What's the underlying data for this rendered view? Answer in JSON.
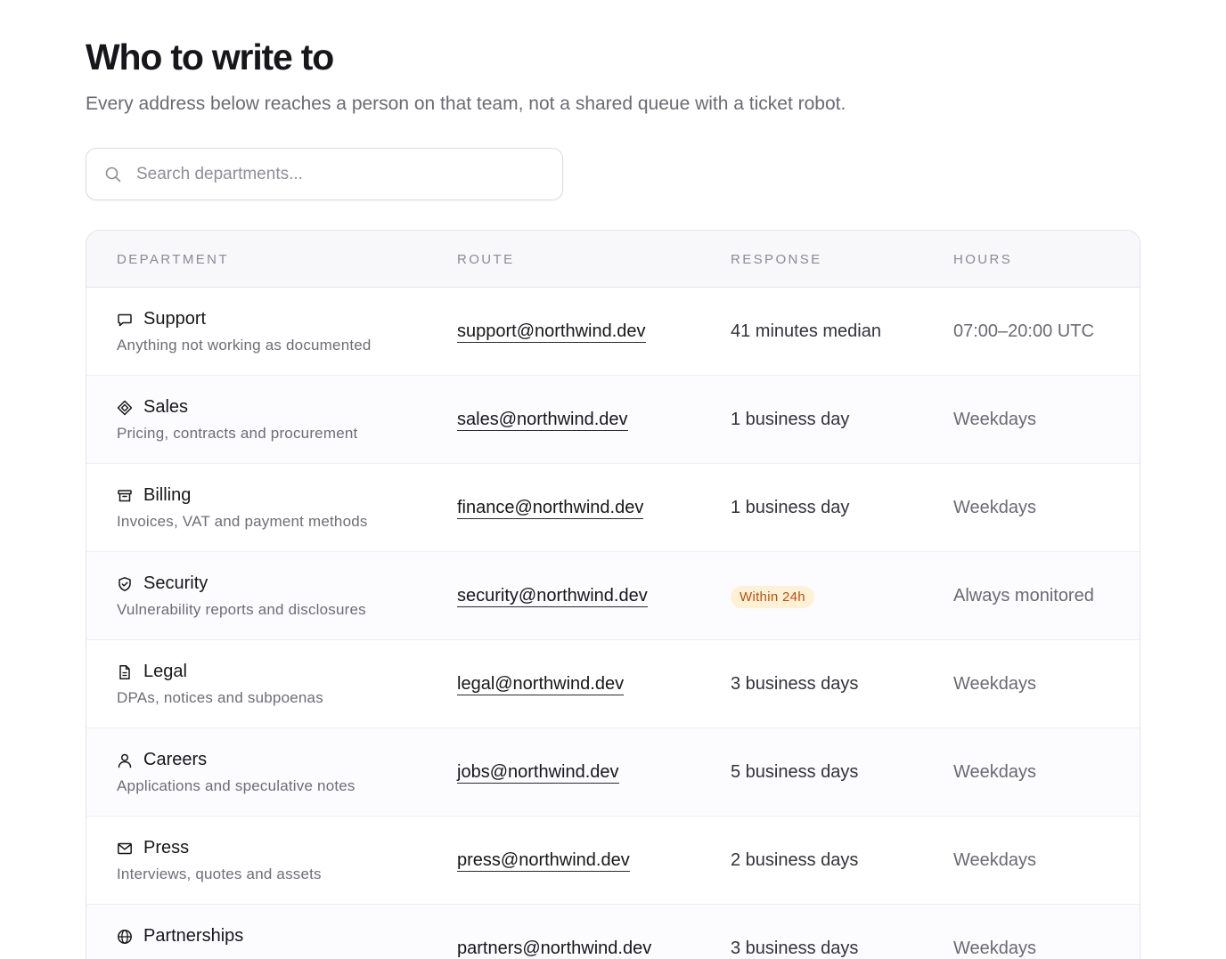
{
  "header": {
    "title": "Who to write to",
    "subtitle": "Every address below reaches a person on that team, not a shared queue with a ticket robot."
  },
  "search": {
    "placeholder": "Search departments...",
    "value": "",
    "icon": "search-icon"
  },
  "table": {
    "columns": [
      "DEPARTMENT",
      "ROUTE",
      "RESPONSE",
      "HOURS"
    ],
    "rows": [
      {
        "icon": "chat-bubble-icon",
        "name": "Support",
        "description": "Anything not working as documented",
        "route": "support@northwind.dev",
        "response": "41 minutes median",
        "hours": "07:00–20:00 UTC"
      },
      {
        "icon": "diamond-icon",
        "name": "Sales",
        "description": "Pricing, contracts and procurement",
        "route": "sales@northwind.dev",
        "response": "1 business day",
        "hours": "Weekdays"
      },
      {
        "icon": "archive-box-icon",
        "name": "Billing",
        "description": "Invoices, VAT and payment methods",
        "route": "finance@northwind.dev",
        "response": "1 business day",
        "hours": "Weekdays"
      },
      {
        "icon": "shield-check-icon",
        "name": "Security",
        "description": "Vulnerability reports and disclosures",
        "route": "security@northwind.dev",
        "response": "Within 24h",
        "hours": "Always monitored"
      },
      {
        "icon": "document-icon",
        "name": "Legal",
        "description": "DPAs, notices and subpoenas",
        "route": "legal@northwind.dev",
        "response": "3 business days",
        "hours": "Weekdays"
      },
      {
        "icon": "user-icon",
        "name": "Careers",
        "description": "Applications and speculative notes",
        "route": "jobs@northwind.dev",
        "response": "5 business days",
        "hours": "Weekdays"
      },
      {
        "icon": "envelope-icon",
        "name": "Press",
        "description": "Interviews, quotes and assets",
        "route": "press@northwind.dev",
        "response": "2 business days",
        "hours": "Weekdays"
      },
      {
        "icon": "globe-icon",
        "name": "Partnerships",
        "description": "",
        "route": "partners@northwind.dev",
        "response": "3 business days",
        "hours": "Weekdays"
      }
    ]
  },
  "colors": {
    "badge_text": "#b4510f",
    "badge_bg": "#fff1d6",
    "border": "#e4e3e9"
  }
}
